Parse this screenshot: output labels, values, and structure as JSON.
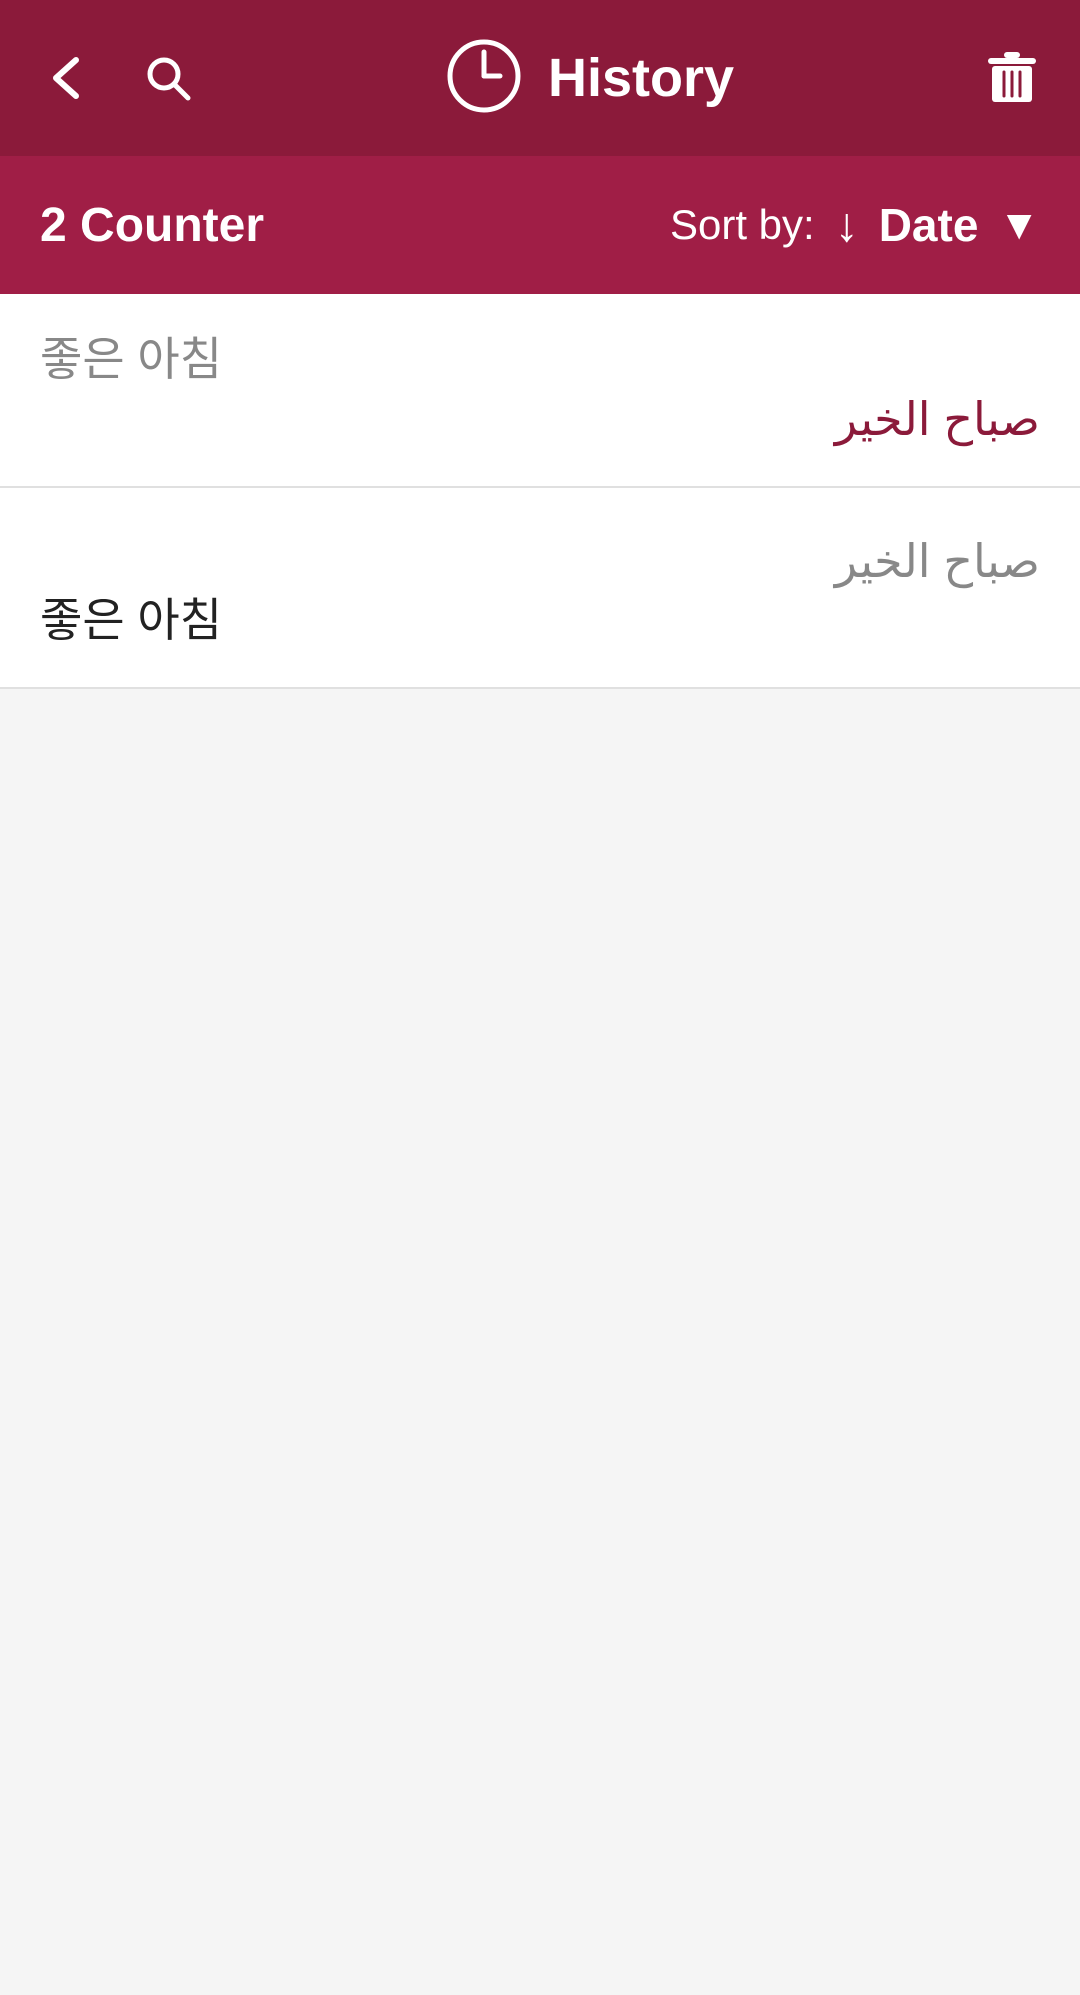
{
  "header": {
    "title": "History",
    "back_label": "←",
    "delete_label": "🗑"
  },
  "sort_bar": {
    "counter_text": "2 Counter",
    "sort_label": "Sort by:",
    "sort_arrow": "↓",
    "sort_value": "Date",
    "sort_chevron": "▼"
  },
  "list_items": [
    {
      "id": 1,
      "source": "좋은 아침",
      "translation": "صباح الخير",
      "source_style": "light",
      "translation_style": "dark"
    },
    {
      "id": 2,
      "source": "좋은 아침",
      "translation": "صباح الخير",
      "source_style": "dark",
      "translation_style": "light"
    }
  ],
  "colors": {
    "header_bg": "#8b1a3a",
    "sort_bar_bg": "#a01e46",
    "text_dark": "#222222",
    "text_light": "#888888",
    "accent": "#8b1a3a"
  }
}
